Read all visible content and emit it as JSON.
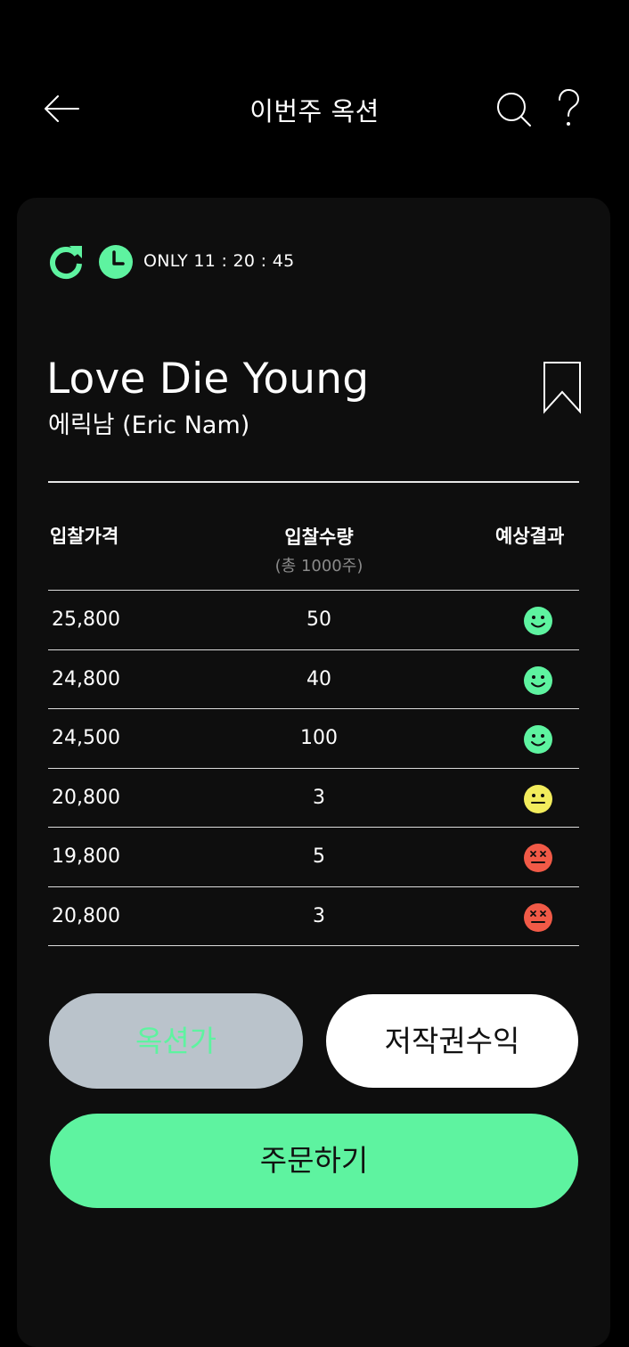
{
  "header": {
    "title": "이번주 옥션"
  },
  "status": {
    "timer": "ONLY 11 : 20 : 45"
  },
  "song": {
    "title": "Love Die Young",
    "artist": "에릭남 (Eric Nam)"
  },
  "table": {
    "headers": {
      "price": "입찰가격",
      "quantity": "입찰수량",
      "quantity_sub": "(총 1000주)",
      "result": "예상결과"
    },
    "rows": [
      {
        "price": "25,800",
        "quantity": "50",
        "result": "happy"
      },
      {
        "price": "24,800",
        "quantity": "40",
        "result": "happy"
      },
      {
        "price": "24,500",
        "quantity": "100",
        "result": "happy"
      },
      {
        "price": "20,800",
        "quantity": "3",
        "result": "neutral"
      },
      {
        "price": "19,800",
        "quantity": "5",
        "result": "dead"
      },
      {
        "price": "20,800",
        "quantity": "3",
        "result": "dead"
      }
    ]
  },
  "buttons": {
    "auction_price": "옥션가",
    "royalty": "저작권수익",
    "order": "주문하기"
  },
  "colors": {
    "accent": "#5ef3a0",
    "happy": "#5ef3a0",
    "neutral": "#f2ec5c",
    "dead": "#f15a47",
    "card": "#0e0e0e",
    "disabled": "#bac3cb"
  },
  "icons": {
    "back": "arrow-left-icon",
    "search": "search-icon",
    "help": "question-mark-icon",
    "refresh": "refresh-icon",
    "clock": "clock-icon",
    "bookmark": "bookmark-icon"
  }
}
